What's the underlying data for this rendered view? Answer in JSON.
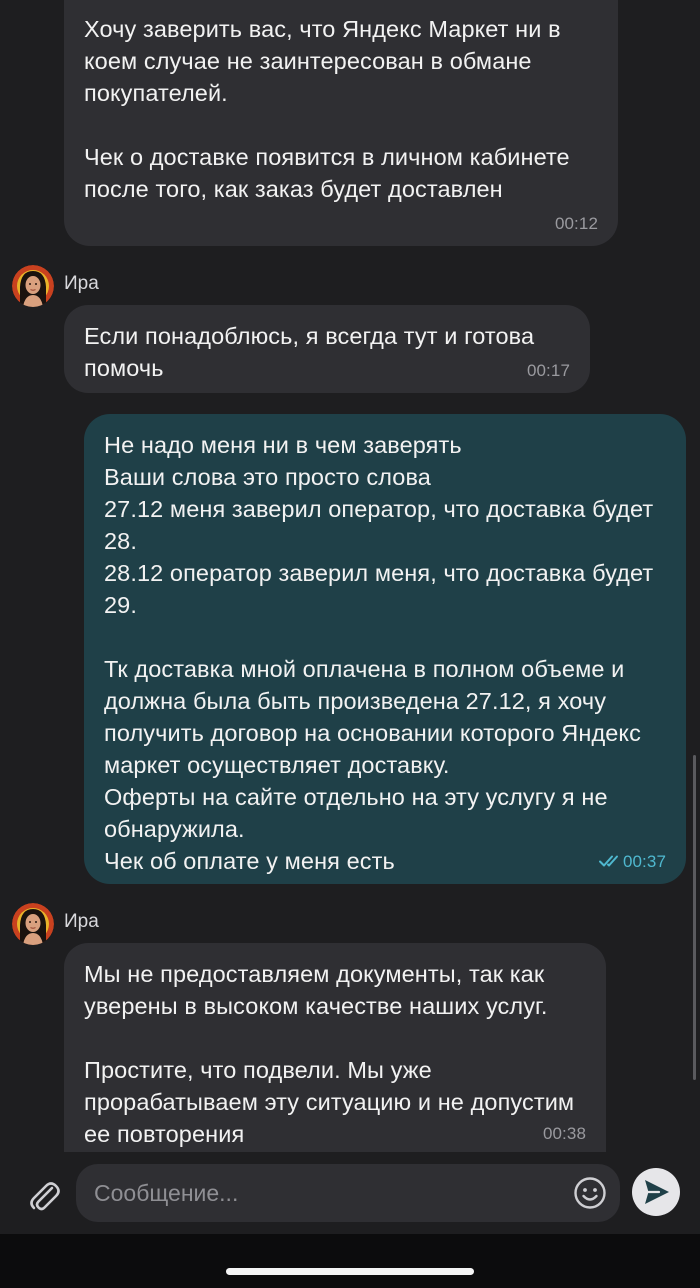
{
  "messages": [
    {
      "direction": "in",
      "text": "Хочу заверить вас, что Яндекс Маркет ни в коем случае не заинтересован в обмане покупателей.\n\nЧек о доставке появится в личном кабинете после того, как заказ будет доставлен",
      "time": "00:12"
    },
    {
      "direction": "in",
      "sender": "Ира",
      "text": "Если понадоблюсь, я всегда тут и готова помочь",
      "time": "00:17"
    },
    {
      "direction": "out",
      "text": "Не надо меня ни в чем заверять\nВаши слова это просто слова\n27.12 меня заверил оператор, что доставка будет 28.\n28.12 оператор заверил меня, что доставка будет 29.\n\nТк доставка мной оплачена в полном объеме и должна была быть произведена 27.12, я хочу получить договор на основании которого Яндекс маркет осуществляет доставку.\nОферты на сайте отдельно на эту услугу я не обнаружила.\nЧек об оплате у меня есть",
      "time": "00:37",
      "status": "read"
    },
    {
      "direction": "in",
      "sender": "Ира",
      "text": "Мы не предоставляем документы, так как уверены в высоком качестве наших услуг.\n\nПростите, что подвели. Мы уже прорабатываем эту ситуацию и не допустим ее повторения",
      "time": "00:38"
    }
  ],
  "composer": {
    "placeholder": "Сообщение...",
    "attach_icon": "paperclip-icon",
    "emoji_icon": "smiley-icon",
    "send_icon": "send-arrow-icon"
  },
  "colors": {
    "background": "#1e1e20",
    "incoming_bubble": "#2f2f33",
    "outgoing_bubble": "#1f4048",
    "read_ticks": "#4fb8cf"
  }
}
